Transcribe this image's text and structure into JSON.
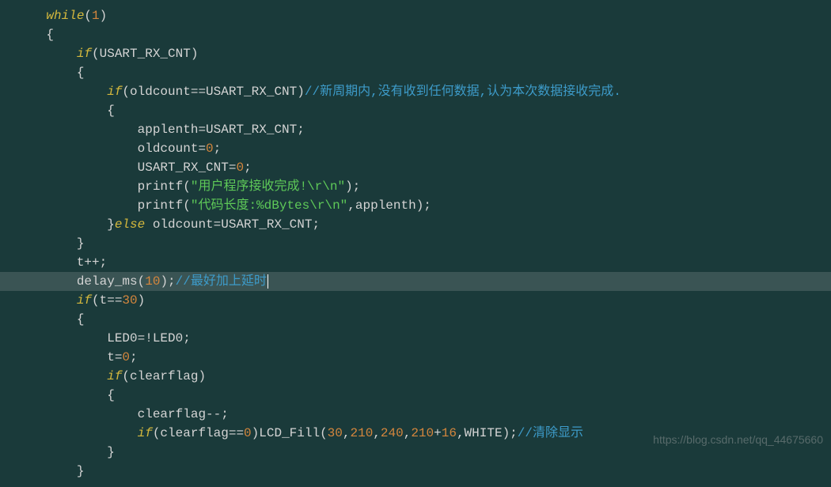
{
  "code": {
    "lines": [
      {
        "indent": 1,
        "tokens": [
          {
            "t": "kw",
            "v": "while"
          },
          {
            "t": "punc",
            "v": "("
          },
          {
            "t": "num",
            "v": "1"
          },
          {
            "t": "punc",
            "v": ")"
          }
        ]
      },
      {
        "indent": 1,
        "tokens": [
          {
            "t": "punc",
            "v": "{"
          }
        ]
      },
      {
        "indent": 2,
        "tokens": [
          {
            "t": "kw",
            "v": "if"
          },
          {
            "t": "punc",
            "v": "(USART_RX_CNT)"
          }
        ]
      },
      {
        "indent": 2,
        "tokens": [
          {
            "t": "punc",
            "v": "{"
          }
        ]
      },
      {
        "indent": 3,
        "tokens": [
          {
            "t": "kw",
            "v": "if"
          },
          {
            "t": "punc",
            "v": "(oldcount==USART_RX_CNT)"
          },
          {
            "t": "cmt",
            "v": "//新周期内,没有收到任何数据,认为本次数据接收完成."
          }
        ]
      },
      {
        "indent": 3,
        "tokens": [
          {
            "t": "punc",
            "v": "{"
          }
        ]
      },
      {
        "indent": 4,
        "tokens": [
          {
            "t": "id",
            "v": "applenth=USART_RX_CNT;"
          }
        ]
      },
      {
        "indent": 4,
        "tokens": [
          {
            "t": "id",
            "v": "oldcount="
          },
          {
            "t": "num",
            "v": "0"
          },
          {
            "t": "punc",
            "v": ";"
          }
        ]
      },
      {
        "indent": 4,
        "tokens": [
          {
            "t": "id",
            "v": "USART_RX_CNT="
          },
          {
            "t": "num",
            "v": "0"
          },
          {
            "t": "punc",
            "v": ";"
          }
        ]
      },
      {
        "indent": 4,
        "tokens": [
          {
            "t": "id",
            "v": "printf("
          },
          {
            "t": "str",
            "v": "\"用户程序接收完成!\\r\\n\""
          },
          {
            "t": "punc",
            "v": ");"
          }
        ]
      },
      {
        "indent": 4,
        "tokens": [
          {
            "t": "id",
            "v": "printf("
          },
          {
            "t": "str",
            "v": "\"代码长度:%dBytes\\r\\n\""
          },
          {
            "t": "punc",
            "v": ",applenth);"
          }
        ]
      },
      {
        "indent": 3,
        "tokens": [
          {
            "t": "punc",
            "v": "}"
          },
          {
            "t": "kw",
            "v": "else"
          },
          {
            "t": "id",
            "v": " oldcount=USART_RX_CNT;"
          }
        ]
      },
      {
        "indent": 2,
        "tokens": [
          {
            "t": "punc",
            "v": "}"
          }
        ]
      },
      {
        "indent": 2,
        "tokens": [
          {
            "t": "id",
            "v": "t++;"
          }
        ]
      },
      {
        "indent": 2,
        "highlighted": true,
        "cursor": true,
        "tokens": [
          {
            "t": "id",
            "v": "delay_ms("
          },
          {
            "t": "num",
            "v": "10"
          },
          {
            "t": "punc",
            "v": ");"
          },
          {
            "t": "cmt",
            "v": "//最好加上延时"
          }
        ]
      },
      {
        "indent": 2,
        "tokens": [
          {
            "t": "kw",
            "v": "if"
          },
          {
            "t": "punc",
            "v": "(t=="
          },
          {
            "t": "num",
            "v": "30"
          },
          {
            "t": "punc",
            "v": ")"
          }
        ]
      },
      {
        "indent": 2,
        "tokens": [
          {
            "t": "punc",
            "v": "{"
          }
        ]
      },
      {
        "indent": 3,
        "tokens": [
          {
            "t": "id",
            "v": "LED0=!LED0;"
          }
        ]
      },
      {
        "indent": 3,
        "tokens": [
          {
            "t": "id",
            "v": "t="
          },
          {
            "t": "num",
            "v": "0"
          },
          {
            "t": "punc",
            "v": ";"
          }
        ]
      },
      {
        "indent": 3,
        "tokens": [
          {
            "t": "kw",
            "v": "if"
          },
          {
            "t": "punc",
            "v": "(clearflag)"
          }
        ]
      },
      {
        "indent": 3,
        "tokens": [
          {
            "t": "punc",
            "v": "{"
          }
        ]
      },
      {
        "indent": 4,
        "tokens": [
          {
            "t": "id",
            "v": "clearflag--;"
          }
        ]
      },
      {
        "indent": 4,
        "tokens": [
          {
            "t": "kw",
            "v": "if"
          },
          {
            "t": "punc",
            "v": "(clearflag=="
          },
          {
            "t": "num",
            "v": "0"
          },
          {
            "t": "punc",
            "v": ")LCD_Fill("
          },
          {
            "t": "num",
            "v": "30"
          },
          {
            "t": "punc",
            "v": ","
          },
          {
            "t": "num",
            "v": "210"
          },
          {
            "t": "punc",
            "v": ","
          },
          {
            "t": "num",
            "v": "240"
          },
          {
            "t": "punc",
            "v": ","
          },
          {
            "t": "num",
            "v": "210"
          },
          {
            "t": "punc",
            "v": "+"
          },
          {
            "t": "num",
            "v": "16"
          },
          {
            "t": "punc",
            "v": ",WHITE);"
          },
          {
            "t": "cmt",
            "v": "//清除显示"
          }
        ]
      },
      {
        "indent": 3,
        "tokens": [
          {
            "t": "punc",
            "v": "}"
          }
        ]
      },
      {
        "indent": 2,
        "tokens": [
          {
            "t": "punc",
            "v": "}"
          }
        ]
      }
    ]
  },
  "watermark": "https://blog.csdn.net/qq_44675660",
  "indent_unit": "    "
}
